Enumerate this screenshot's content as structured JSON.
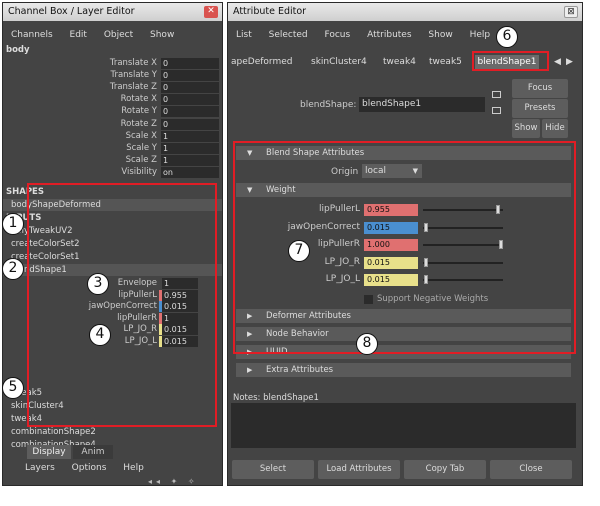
{
  "channel_box": {
    "title": "Channel Box / Layer Editor",
    "close_icon": "close-icon",
    "menu": [
      "Channels",
      "Edit",
      "Object",
      "Show"
    ],
    "node": "body",
    "channels": [
      {
        "label": "Translate X",
        "value": "0"
      },
      {
        "label": "Translate Y",
        "value": "0"
      },
      {
        "label": "Translate Z",
        "value": "0"
      },
      {
        "label": "Rotate X",
        "value": "0"
      },
      {
        "label": "Rotate Y",
        "value": "0"
      },
      {
        "label": "Rotate Z",
        "value": "0"
      },
      {
        "label": "Scale X",
        "value": "1"
      },
      {
        "label": "Scale Y",
        "value": "1"
      },
      {
        "label": "Scale Z",
        "value": "1"
      },
      {
        "label": "Visibility",
        "value": "on"
      }
    ],
    "shapes_header": "SHAPES",
    "shape": "bodyShapeDeformed",
    "inputs_header": "INPUTS",
    "inputs": [
      "polyTweakUV2",
      "createColorSet2",
      "createColorSet1",
      "blendShape1"
    ],
    "blend_attrs": [
      {
        "label": "Envelope",
        "value": "1",
        "color": ""
      },
      {
        "label": "lipPullerL",
        "value": "0.955",
        "color": "#e07070"
      },
      {
        "label": "jawOpenCorrect",
        "value": "0.015",
        "color": "#4a8fd0"
      },
      {
        "label": "lipPullerR",
        "value": "1",
        "color": "#e07070"
      },
      {
        "label": "LP_JO_R",
        "value": "0.015",
        "color": "#e8e08a"
      },
      {
        "label": "LP_JO_L",
        "value": "0.015",
        "color": "#e8e08a"
      }
    ],
    "more_inputs": [
      "tweak5",
      "skinCluster4",
      "tweak4",
      "combinationShape2",
      "combinationShape4"
    ],
    "tabs": [
      "Display",
      "Anim"
    ],
    "bottom_menu": [
      "Layers",
      "Options",
      "Help"
    ]
  },
  "attr_editor": {
    "title": "Attribute Editor",
    "menu": [
      "List",
      "Selected",
      "Focus",
      "Attributes",
      "Show",
      "Help"
    ],
    "tabs": [
      "apeDeformed",
      "skinCluster4",
      "tweak4",
      "tweak5",
      "blendShape1"
    ],
    "node_label": "blendShape:",
    "node_value": "blendShape1",
    "buttons": [
      "Focus",
      "Presets",
      "Show",
      "Hide"
    ],
    "section1": "Blend Shape Attributes",
    "origin_label": "Origin",
    "origin_value": "local",
    "weight_header": "Weight",
    "weights": [
      {
        "label": "lipPullerL",
        "value": "0.955",
        "color": "#e07070",
        "level": 0.955
      },
      {
        "label": "jawOpenCorrect",
        "value": "0.015",
        "color": "#4a8fd0",
        "level": 0.015
      },
      {
        "label": "lipPullerR",
        "value": "1.000",
        "color": "#e07070",
        "level": 1.0
      },
      {
        "label": "LP_JO_R",
        "value": "0.015",
        "color": "#e8e08a",
        "level": 0.015
      },
      {
        "label": "LP_JO_L",
        "value": "0.015",
        "color": "#e8e08a",
        "level": 0.015
      }
    ],
    "neg_weights": "Support Negative Weights",
    "collapsed": [
      "Deformer Attributes",
      "Node Behavior",
      "UUID",
      "Extra Attributes"
    ],
    "notes": "Notes: blendShape1",
    "bottom_buttons": [
      "Select",
      "Load Attributes",
      "Copy Tab",
      "Close"
    ]
  },
  "callouts": [
    "1",
    "2",
    "3",
    "4",
    "5",
    "6",
    "7",
    "8"
  ],
  "colors": {
    "highlight": "#e11d25",
    "panel": "#444444"
  }
}
